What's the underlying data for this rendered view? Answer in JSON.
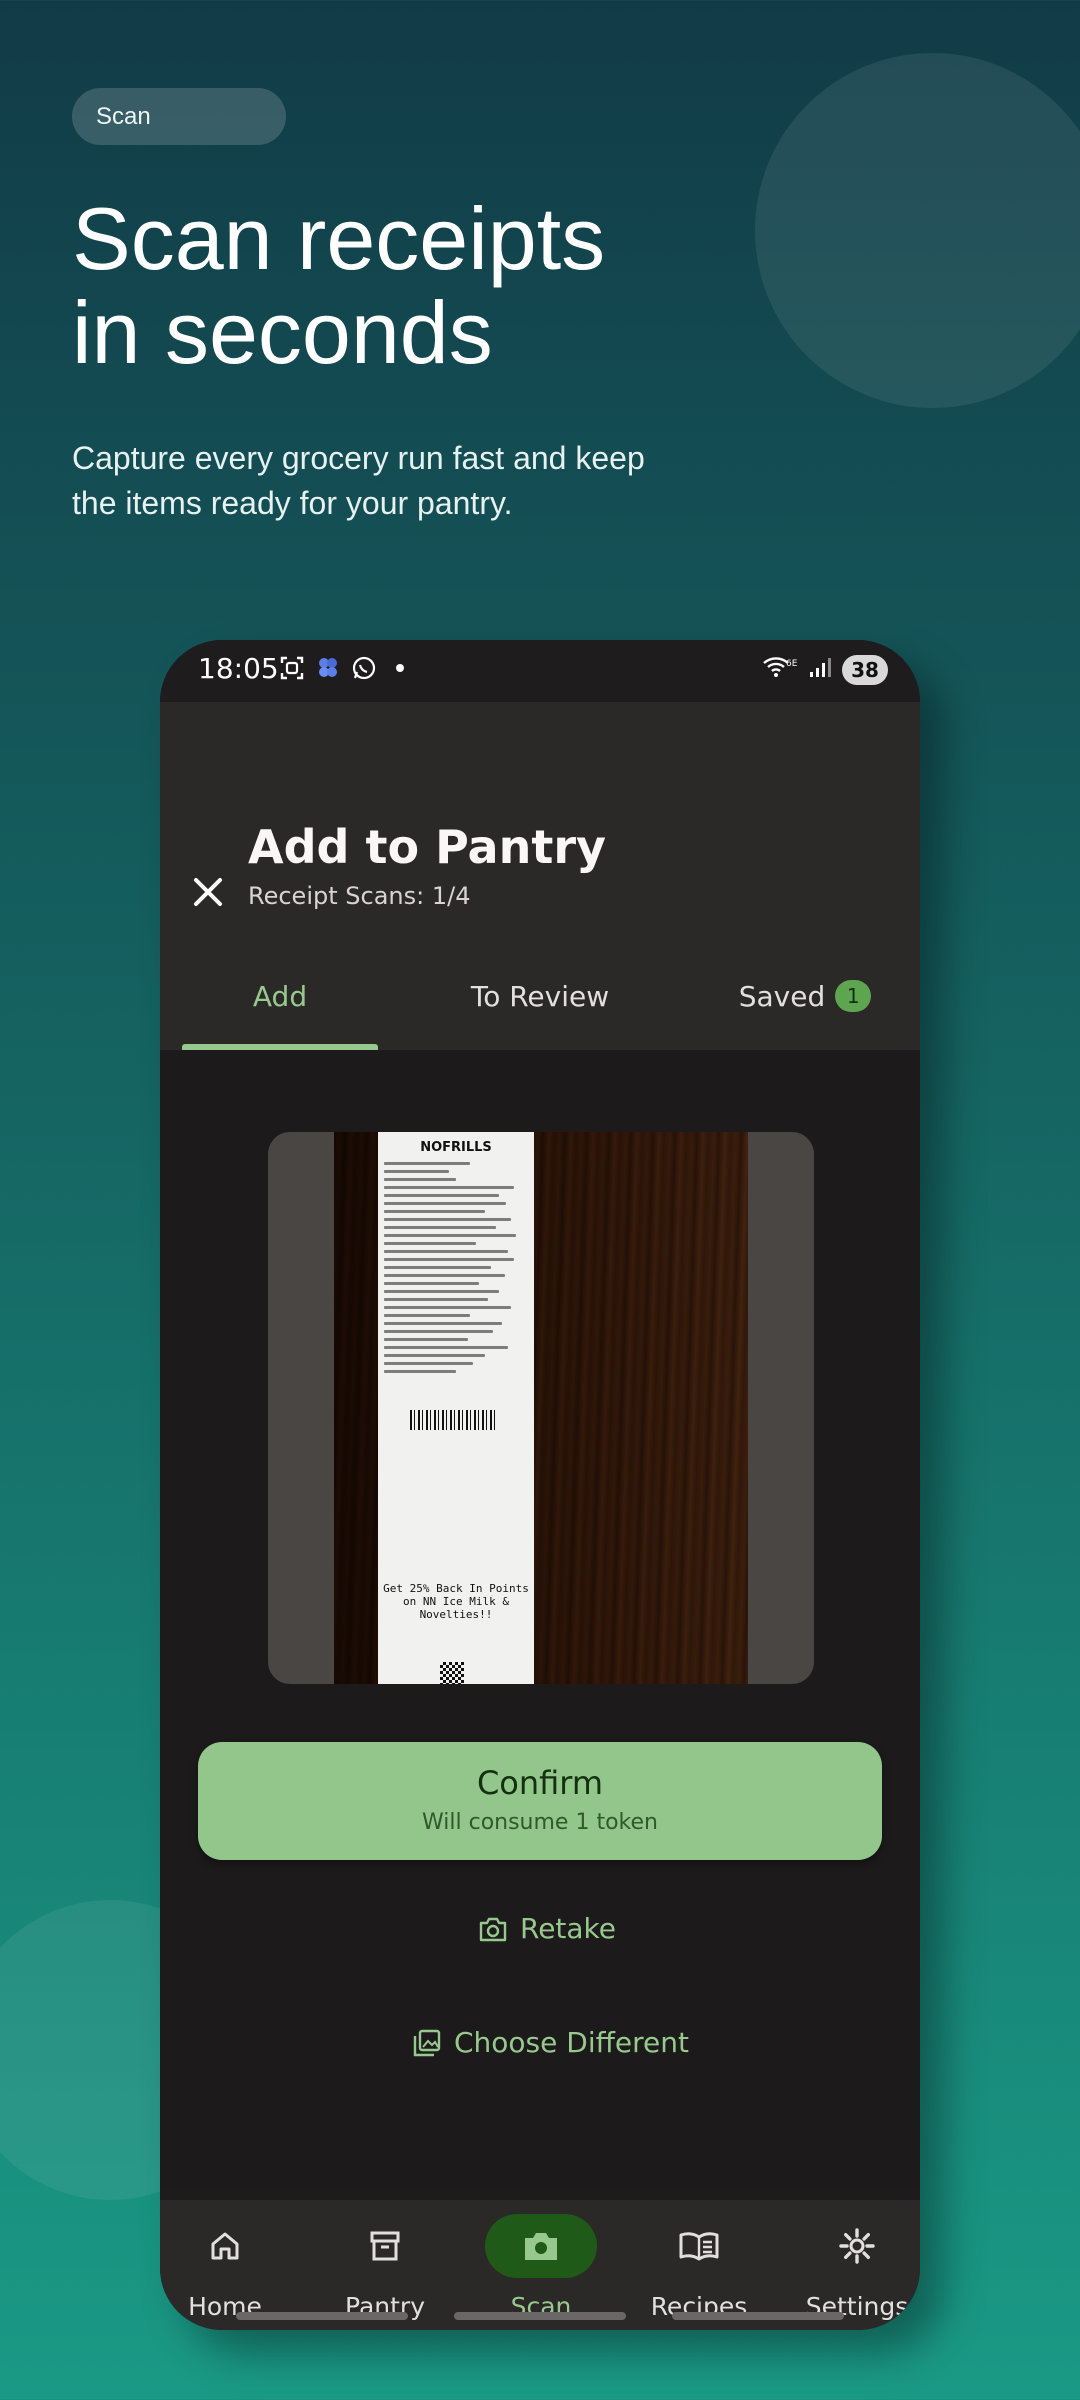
{
  "promo": {
    "tag": "Scan",
    "headline_line1": "Scan receipts",
    "headline_line2": "in seconds",
    "subtitle_line1": "Capture every grocery run fast and keep",
    "subtitle_line2": "the items ready for your pantry."
  },
  "status_bar": {
    "time": "18:05",
    "battery": "38",
    "network": "6E"
  },
  "app_bar": {
    "title": "Add to Pantry",
    "subtitle": "Receipt Scans: 1/4"
  },
  "tabs": [
    {
      "label": "Add",
      "active": true
    },
    {
      "label": "To Review",
      "active": false
    },
    {
      "label": "Saved",
      "badge": "1",
      "active": false
    }
  ],
  "receipt": {
    "store": "NOFRILLS",
    "promo_text": "Get 25% Back In Points on NN Ice Milk & Novelties!!"
  },
  "actions": {
    "confirm_label": "Confirm",
    "confirm_sub": "Will consume 1 token",
    "retake_label": "Retake",
    "choose_label": "Choose Different"
  },
  "bottom_nav": [
    {
      "label": "Home",
      "icon": "home-icon"
    },
    {
      "label": "Pantry",
      "icon": "archive-icon"
    },
    {
      "label": "Scan",
      "icon": "camera-icon",
      "active": true
    },
    {
      "label": "Recipes",
      "icon": "book-icon"
    },
    {
      "label": "Settings",
      "icon": "gear-icon"
    }
  ],
  "colors": {
    "accent": "#97c98e",
    "surface": "#2b2828",
    "background": "#1c1a1a"
  }
}
